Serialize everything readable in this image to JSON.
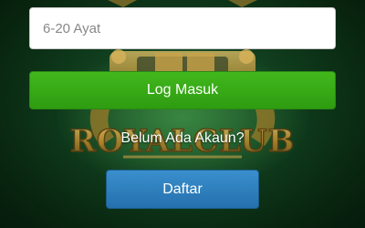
{
  "background": {
    "logo_text": "ROYALCLUB",
    "base_color": "#0f3b1c",
    "logo_color": "#b8892e"
  },
  "form": {
    "password_placeholder": "6-20 Ayat",
    "login_label": "Log Masuk",
    "login_color": "#35a816",
    "no_account_text": "Belum Ada Akaun?",
    "register_label": "Daftar",
    "register_color": "#2e7fc0"
  }
}
